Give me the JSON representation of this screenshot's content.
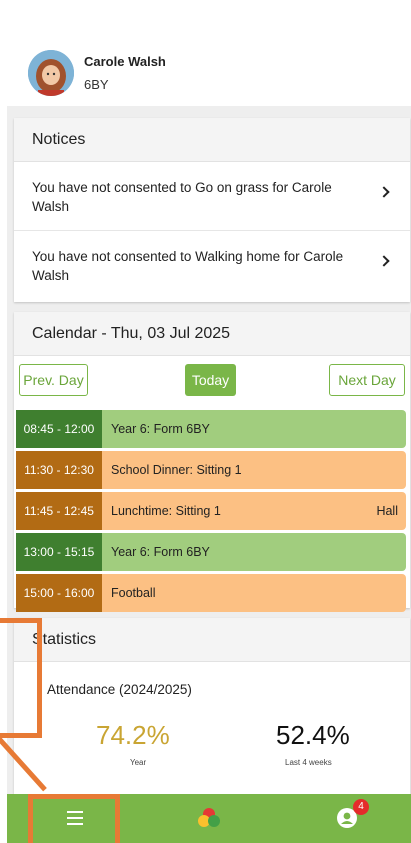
{
  "profile": {
    "name": "Carole Walsh",
    "class": "6BY"
  },
  "notices": {
    "title": "Notices",
    "items": [
      {
        "text": "You have not consented to Go on grass for Carole Walsh"
      },
      {
        "text": "You have not consented to Walking home for Carole Walsh"
      }
    ]
  },
  "calendar": {
    "title": "Calendar - Thu, 03 Jul 2025",
    "prev_label": "Prev. Day",
    "today_label": "Today",
    "next_label": "Next Day",
    "events": [
      {
        "time": "08:45 - 12:00",
        "title": "Year 6: Form 6BY",
        "location": "",
        "color": "green"
      },
      {
        "time": "11:30 - 12:30",
        "title": "School Dinner: Sitting 1",
        "location": "",
        "color": "orange"
      },
      {
        "time": "11:45 - 12:45",
        "title": "Lunchtime: Sitting 1",
        "location": "Hall",
        "color": "orange"
      },
      {
        "time": "13:00 - 15:15",
        "title": "Year 6: Form 6BY",
        "location": "",
        "color": "green"
      },
      {
        "time": "15:00 - 16:00",
        "title": "Football",
        "location": "",
        "color": "orange"
      }
    ]
  },
  "statistics": {
    "title": "Statistics",
    "attendance_label": "Attendance (2024/2025)",
    "year_value": "74.2%",
    "year_label": "Year",
    "recent_value": "52.4%",
    "recent_label": "Last 4 weeks"
  },
  "nav": {
    "badge_count": "4",
    "icons": [
      "menu-icon",
      "app-logo-icon",
      "profile-icon"
    ]
  },
  "colors": {
    "accent": "#7ab648",
    "green_event": "#a1cd7e",
    "orange_event": "#fcc083",
    "annotation": "#e77a35",
    "year_stat": "#c9a533"
  }
}
